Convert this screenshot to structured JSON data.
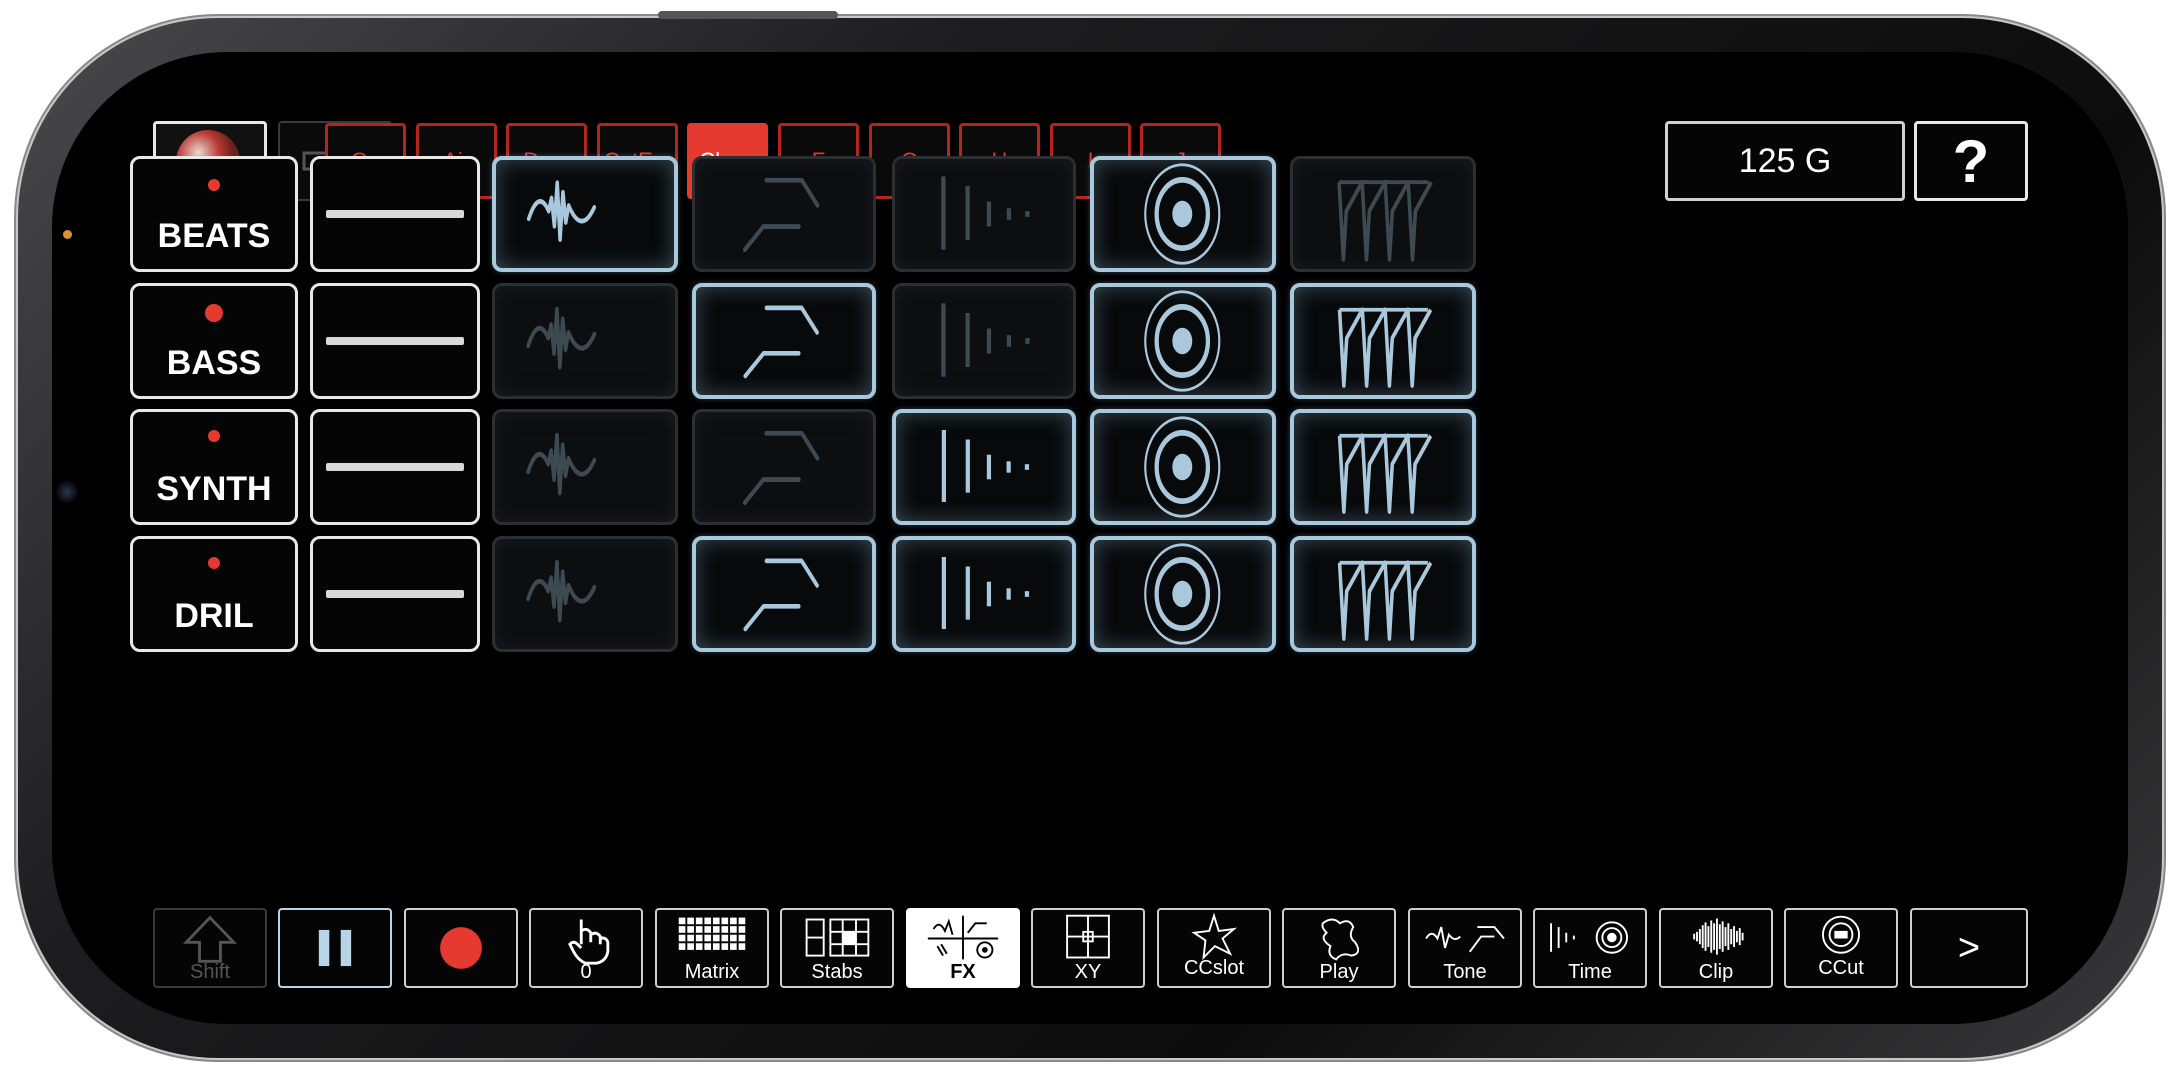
{
  "top_bar": {
    "link_icon": "link-arrows-icon",
    "scenes": [
      {
        "label": "Go",
        "active": false
      },
      {
        "label": "Air",
        "active": false
      },
      {
        "label": "Dem",
        "active": false
      },
      {
        "label": "CutEm",
        "active": false
      },
      {
        "label": "Close",
        "active": true
      },
      {
        "label": "F",
        "active": false
      },
      {
        "label": "G",
        "active": false
      },
      {
        "label": "H",
        "active": false
      },
      {
        "label": "I",
        "active": false
      },
      {
        "label": "J",
        "active": false
      }
    ],
    "tempo_key": "125 G",
    "help_label": "?"
  },
  "tracks": [
    {
      "name": "BEATS",
      "fx_on": [
        true,
        false,
        false,
        true,
        false
      ]
    },
    {
      "name": "BASS",
      "fx_on": [
        false,
        true,
        false,
        true,
        true
      ]
    },
    {
      "name": "SYNTH",
      "fx_on": [
        false,
        false,
        true,
        true,
        true
      ]
    },
    {
      "name": "DRIL",
      "fx_on": [
        false,
        true,
        true,
        true,
        true
      ]
    }
  ],
  "fx_pad_icons": [
    "wave-icon",
    "filter-icon",
    "delay-bars-icon",
    "target-icon",
    "gate-icon"
  ],
  "bottom_bar": {
    "shift_label": "Shift",
    "pause_icon": "pause-icon",
    "record_icon": "record-icon",
    "touch_label": "0",
    "matrix_label": "Matrix",
    "stabs_label": "Stabs",
    "fx_label": "FX",
    "xy_label": "XY",
    "ccslot_label": "CCslot",
    "play_label": "Play",
    "tone_label": "Tone",
    "time_label": "Time",
    "clip_label": "Clip",
    "ccut_label": "CCut",
    "next_label": ">"
  },
  "colors": {
    "accent_red": "#e53a2f",
    "pad_active": "#a9c8dc",
    "pad_inactive": "#3e4a52"
  }
}
